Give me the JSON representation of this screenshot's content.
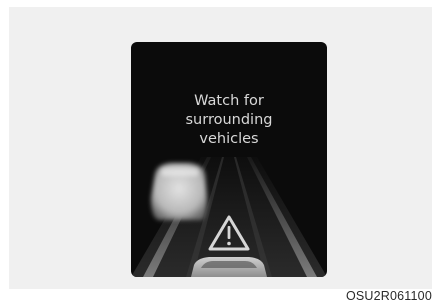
{
  "display": {
    "message_lines": [
      "Watch for",
      "surrounding",
      "vehicles"
    ],
    "warning_icon": "warning-triangle-icon",
    "colors": {
      "panel_background": "#f0f0f0",
      "screen_background": "#0b0b0b",
      "text": "#d8d8d8"
    }
  },
  "figure_code": "OSU2R061100"
}
